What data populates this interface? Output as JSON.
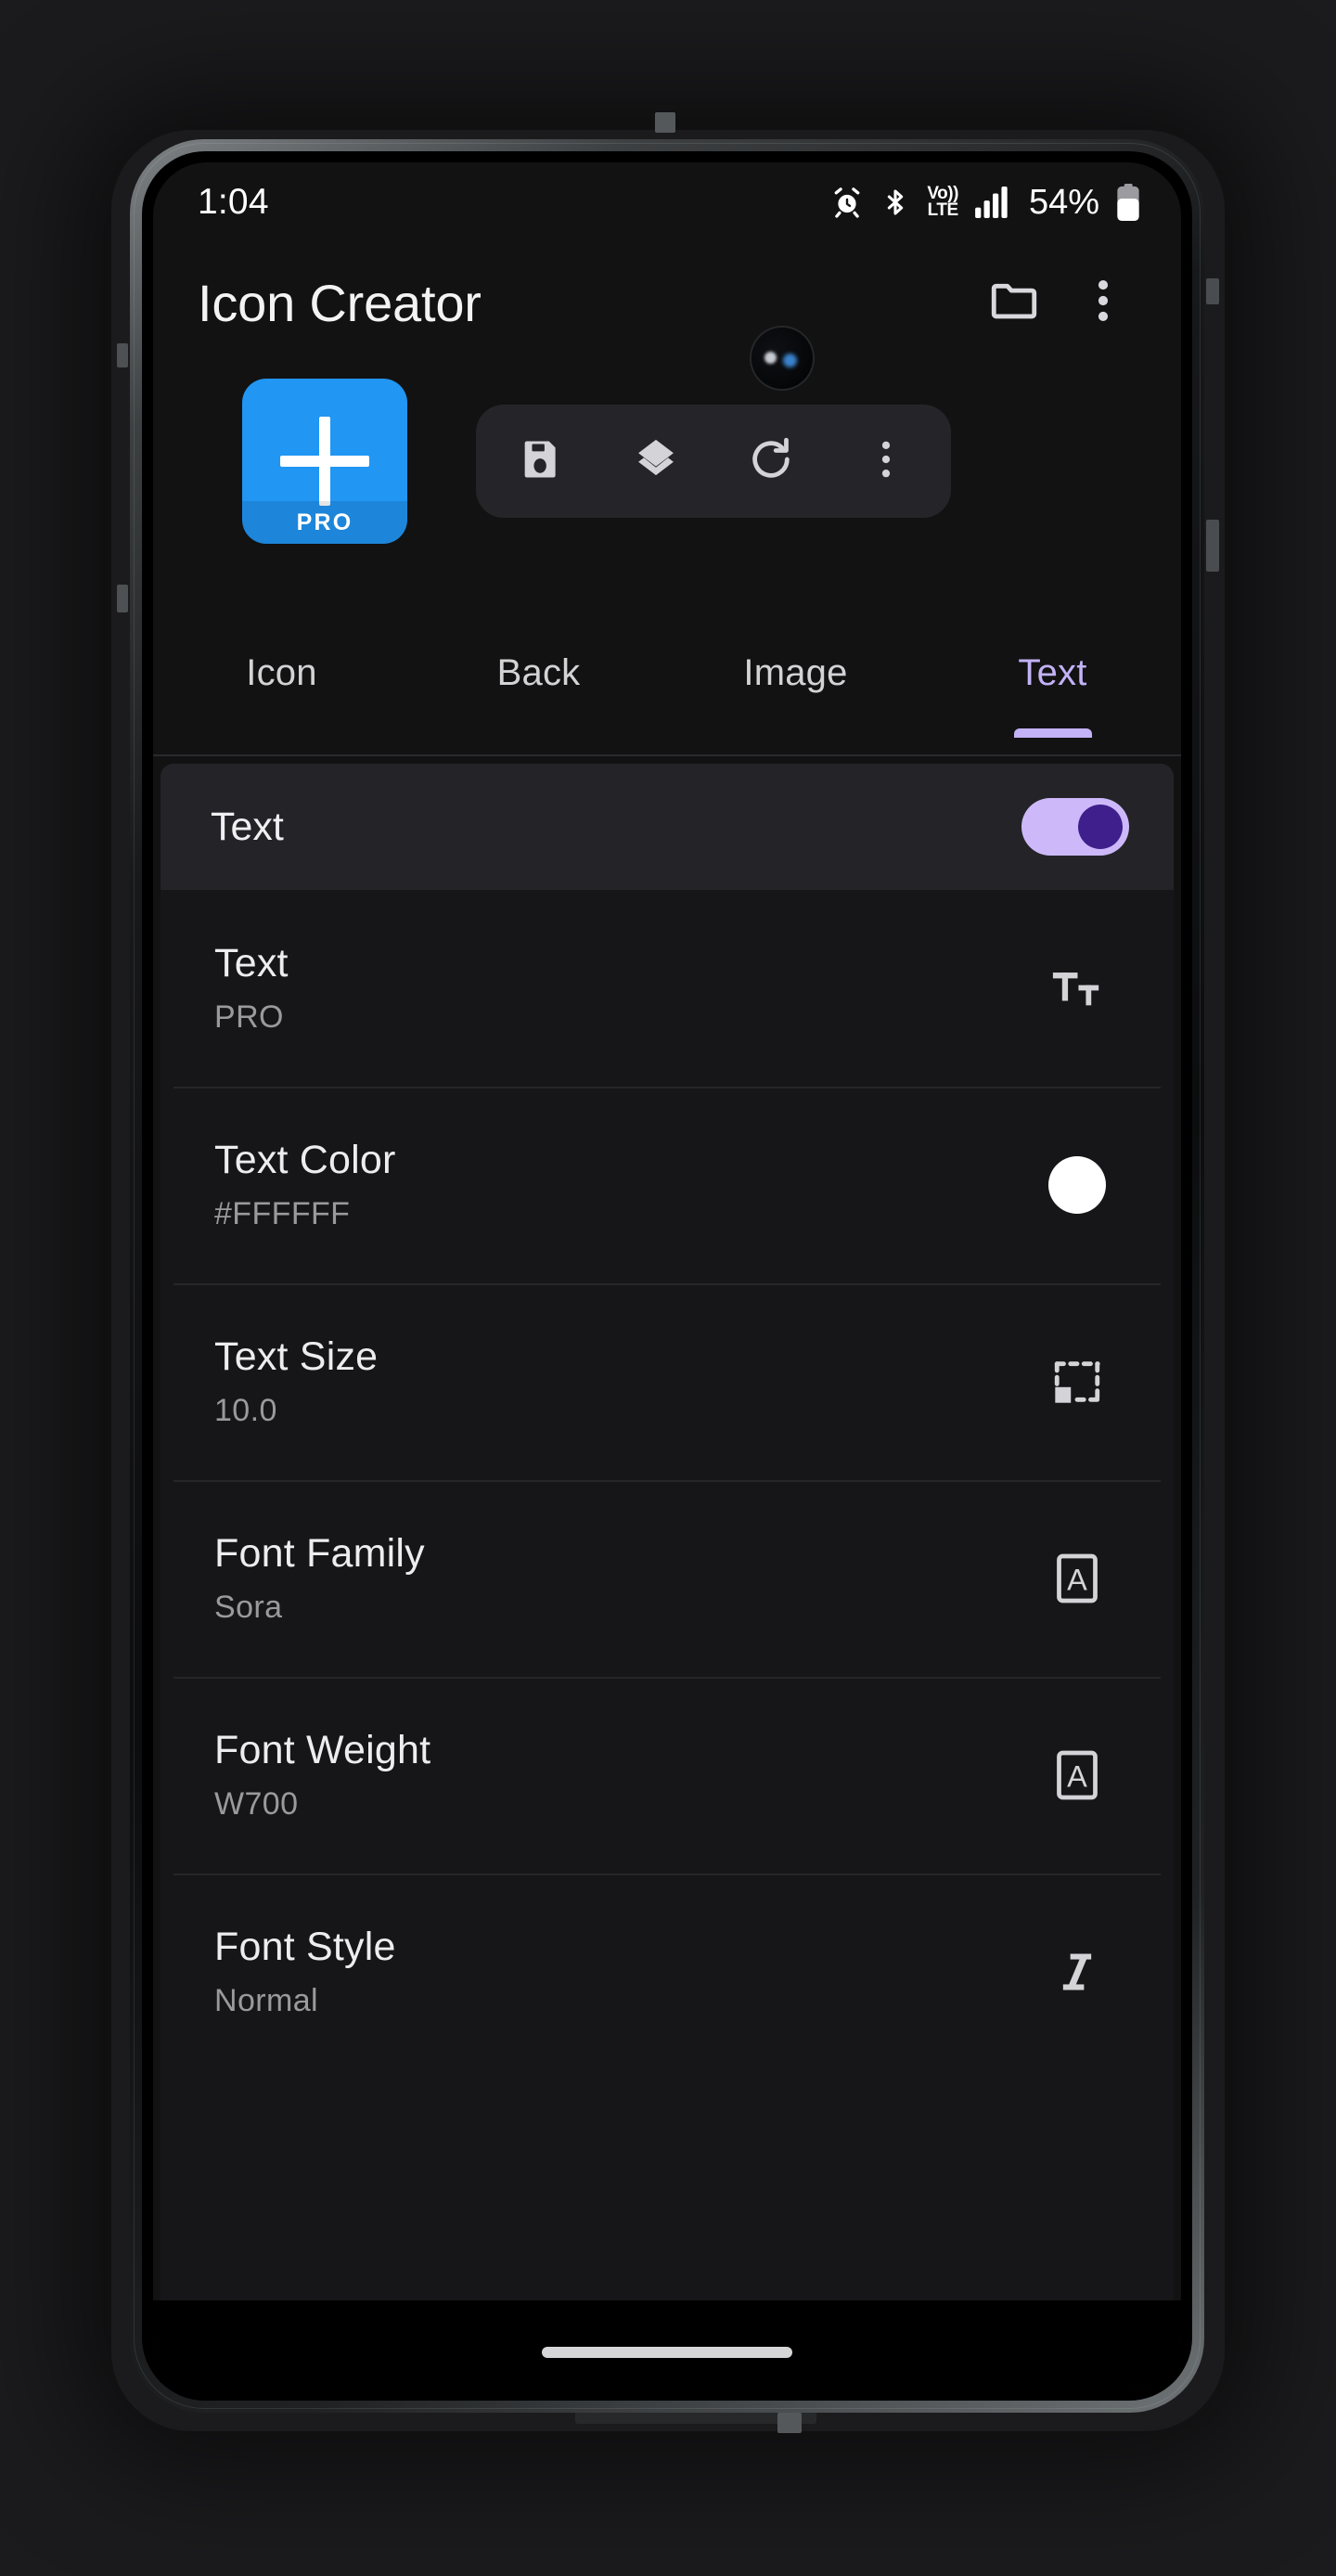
{
  "status_bar": {
    "time": "1:04",
    "battery_percent": "54%",
    "icons": [
      "alarm-icon",
      "bluetooth-icon",
      "volte-icon",
      "signal-icon",
      "battery-icon"
    ],
    "volte_top": "Vo))",
    "volte_bottom": "LTE"
  },
  "app_bar": {
    "title": "Icon Creator",
    "actions": [
      "folder-icon",
      "overflow-menu-icon"
    ]
  },
  "action_strip": {
    "add_button": {
      "name": "add-icon",
      "badge": "PRO"
    },
    "tools": [
      "save-icon",
      "layers-icon",
      "refresh-icon",
      "overflow-menu-icon"
    ]
  },
  "tabs": [
    {
      "label": "Icon",
      "active": false
    },
    {
      "label": "Back",
      "active": false
    },
    {
      "label": "Image",
      "active": false
    },
    {
      "label": "Text",
      "active": true
    }
  ],
  "master_toggle": {
    "label": "Text",
    "enabled": true
  },
  "settings": [
    {
      "title": "Text",
      "value": "PRO",
      "icon": "text-format-icon"
    },
    {
      "title": "Text Color",
      "value": "#FFFFFF",
      "icon": "color-swatch-icon",
      "swatch": "#FFFFFF"
    },
    {
      "title": "Text Size",
      "value": "10.0",
      "icon": "resize-icon"
    },
    {
      "title": "Font Family",
      "value": "Sora",
      "icon": "font-family-icon"
    },
    {
      "title": "Font Weight",
      "value": "W700",
      "icon": "font-weight-icon"
    },
    {
      "title": "Font Style",
      "value": "Normal",
      "icon": "italic-icon"
    }
  ],
  "colors": {
    "accent_purple": "#C3B2F7",
    "toggle_track": "#CDB9FA",
    "toggle_knob": "#3F1F8C",
    "add_button_blue": "#2196F3",
    "screen_bg": "#121212",
    "panel_bg": "#161618",
    "row_highlight": "#242428"
  }
}
